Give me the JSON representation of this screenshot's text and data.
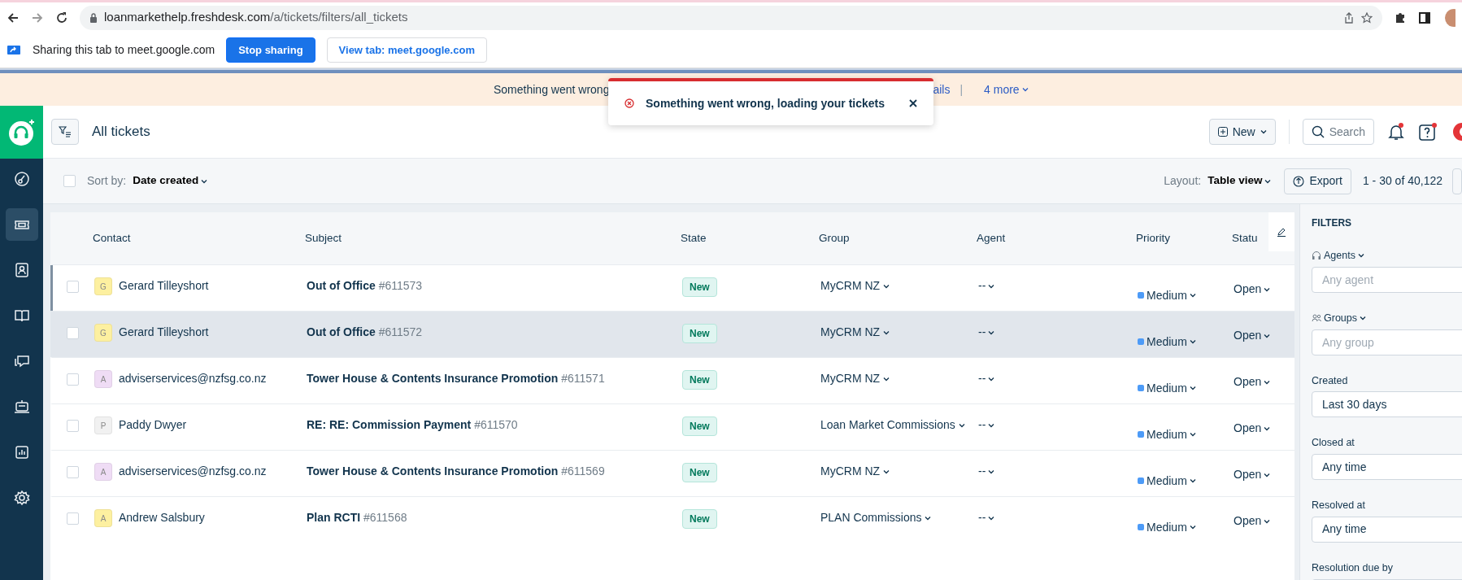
{
  "browser": {
    "url_host": "loanmarkethelp.freshdesk.com",
    "url_path": "/a/tickets/filters/all_tickets"
  },
  "sharing_bar": {
    "text": "Sharing this tab to meet.google.com",
    "stop_button": "Stop sharing",
    "view_button": "View tab: meet.google.com"
  },
  "banner": {
    "text": "Something went wrong",
    "link": "ails",
    "separator": "|",
    "more": "4 more"
  },
  "toast": {
    "message": "Something went wrong, loading your tickets"
  },
  "sidebar": {
    "items": [
      {
        "selected": false
      },
      {
        "selected": true
      },
      {
        "selected": false
      },
      {
        "selected": false
      },
      {
        "selected": false
      },
      {
        "selected": false
      },
      {
        "selected": false
      },
      {
        "selected": false
      }
    ]
  },
  "header": {
    "title": "All tickets",
    "new_button": "New",
    "search_button": "Search"
  },
  "toolbar": {
    "select_all_checked": false,
    "sort_label": "Sort by:",
    "sort_value": "Date created",
    "layout_label": "Layout:",
    "layout_value": "Table view",
    "export_button": "Export",
    "count": "1 - 30 of 40,122"
  },
  "table": {
    "columns": [
      "Contact",
      "Subject",
      "State",
      "Group",
      "Agent",
      "Priority",
      "Statu"
    ],
    "rows": [
      {
        "checked": false,
        "focused": true,
        "highlighted": false,
        "avatar": "G",
        "color": "#fdf0a0",
        "contact": "Gerard Tilleyshort",
        "subject": "**Out of Office** #611573",
        "state": "New",
        "group": "MyCRM NZ",
        "agent": "--",
        "priority": "Medium",
        "status": "Open"
      },
      {
        "checked": false,
        "focused": false,
        "highlighted": true,
        "avatar": "G",
        "color": "#fdf0a0",
        "contact": "Gerard Tilleyshort",
        "subject": "**Out of Office** #611572",
        "state": "New",
        "group": "MyCRM NZ",
        "agent": "--",
        "priority": "Medium",
        "status": "Open"
      },
      {
        "checked": false,
        "focused": false,
        "highlighted": false,
        "avatar": "A",
        "color": "#efdcf5",
        "contact": "adviserservices@nzfsg.co.nz",
        "subject": "**Tower House & Contents Insurance Promotion** #611571",
        "state": "New",
        "group": "MyCRM NZ",
        "agent": "--",
        "priority": "Medium",
        "status": "Open"
      },
      {
        "checked": false,
        "focused": false,
        "highlighted": false,
        "avatar": "P",
        "color": "#f1f1f1",
        "contact": "Paddy Dwyer",
        "subject": "**RE: RE: Commission Payment** #611570",
        "state": "New",
        "group": "Loan Market Commissions",
        "agent": "--",
        "priority": "Medium",
        "status": "Open"
      },
      {
        "checked": false,
        "focused": false,
        "highlighted": false,
        "avatar": "A",
        "color": "#efdcf5",
        "contact": "adviserservices@nzfsg.co.nz",
        "subject": "**Tower House & Contents Insurance Promotion** #611569",
        "state": "New",
        "group": "MyCRM NZ",
        "agent": "--",
        "priority": "Medium",
        "status": "Open"
      },
      {
        "checked": false,
        "focused": false,
        "highlighted": false,
        "avatar": "A",
        "color": "#fdf0a0",
        "contact": "Andrew Salsbury",
        "subject": "**Plan RCTI** #611568",
        "state": "New",
        "group": "PLAN Commissions",
        "agent": "--",
        "priority": "Medium",
        "status": "Open"
      }
    ]
  },
  "filters": {
    "title": "FILTERS",
    "fields": [
      {
        "kind": "dropdown",
        "label": "Agents",
        "placeholder": "Any agent"
      },
      {
        "kind": "dropdown",
        "label": "Groups",
        "placeholder": "Any group"
      },
      {
        "kind": "select",
        "label": "Created",
        "value": "Last 30 days"
      },
      {
        "kind": "select",
        "label": "Closed at",
        "value": "Any time"
      },
      {
        "kind": "select",
        "label": "Resolved at",
        "value": "Any time"
      },
      {
        "kind": "select",
        "label": "Resolution due by"
      }
    ]
  }
}
